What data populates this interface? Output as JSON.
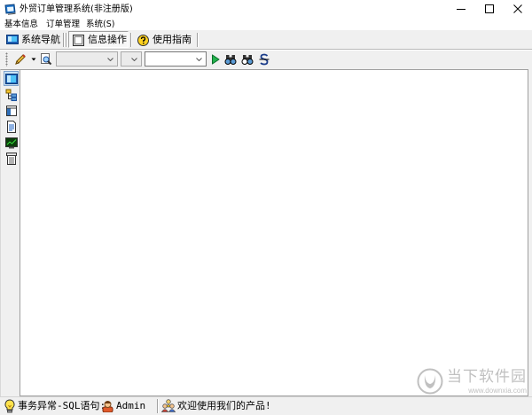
{
  "window": {
    "title": "外贸订单管理系统(非注册版)",
    "icon": "app-window-icon",
    "controls": [
      "minimize-icon",
      "maximize-icon",
      "close-icon"
    ]
  },
  "menu": {
    "items": [
      {
        "label": "基本信息"
      },
      {
        "label": "订单管理"
      },
      {
        "label": "系统(S)"
      }
    ]
  },
  "tabbar": {
    "items": [
      {
        "label": "系统导航",
        "icon": "navigation-window-icon",
        "active": false
      },
      {
        "label": "信息操作",
        "icon": "info-operation-icon",
        "active": true
      },
      {
        "label": "使用指南",
        "icon": "help-icon",
        "active": false
      }
    ]
  },
  "toolbar": {
    "buttons": [
      "pencil-icon",
      "dropdown-arrow-icon",
      "search-document-icon",
      "run-icon",
      "find-icon",
      "find-next-icon",
      "strike-s-icon"
    ],
    "combos": [
      {
        "enabled": false
      },
      {
        "enabled": false
      },
      {
        "enabled": true
      }
    ]
  },
  "sidebar": {
    "items": [
      {
        "icon": "window-view-icon",
        "selected": true
      },
      {
        "icon": "tree-view-icon",
        "selected": false
      },
      {
        "icon": "panel-view-icon",
        "selected": false
      },
      {
        "icon": "document-icon",
        "selected": false
      },
      {
        "icon": "chart-icon",
        "selected": false
      },
      {
        "icon": "list-icon",
        "selected": false
      }
    ]
  },
  "statusbar": {
    "status_icon": "lightbulb-icon",
    "status_text": "事务异常-SQL语句:",
    "user_icon": "user-icon",
    "user": "Admin",
    "welcome_icon": "group-icon",
    "welcome_text": "欢迎使用我们的产品!"
  },
  "watermark": {
    "logo": "downxia-logo-icon",
    "name": "当下软件园",
    "url": "www.downxia.com"
  },
  "colors": {
    "titlebar_bg": "#ffffff",
    "chrome_bg": "#f0f0f0",
    "content_bg": "#ffffff",
    "selection_bg": "#cce4f7",
    "selection_border": "#7da2ce",
    "run_green": "#22b14c"
  }
}
